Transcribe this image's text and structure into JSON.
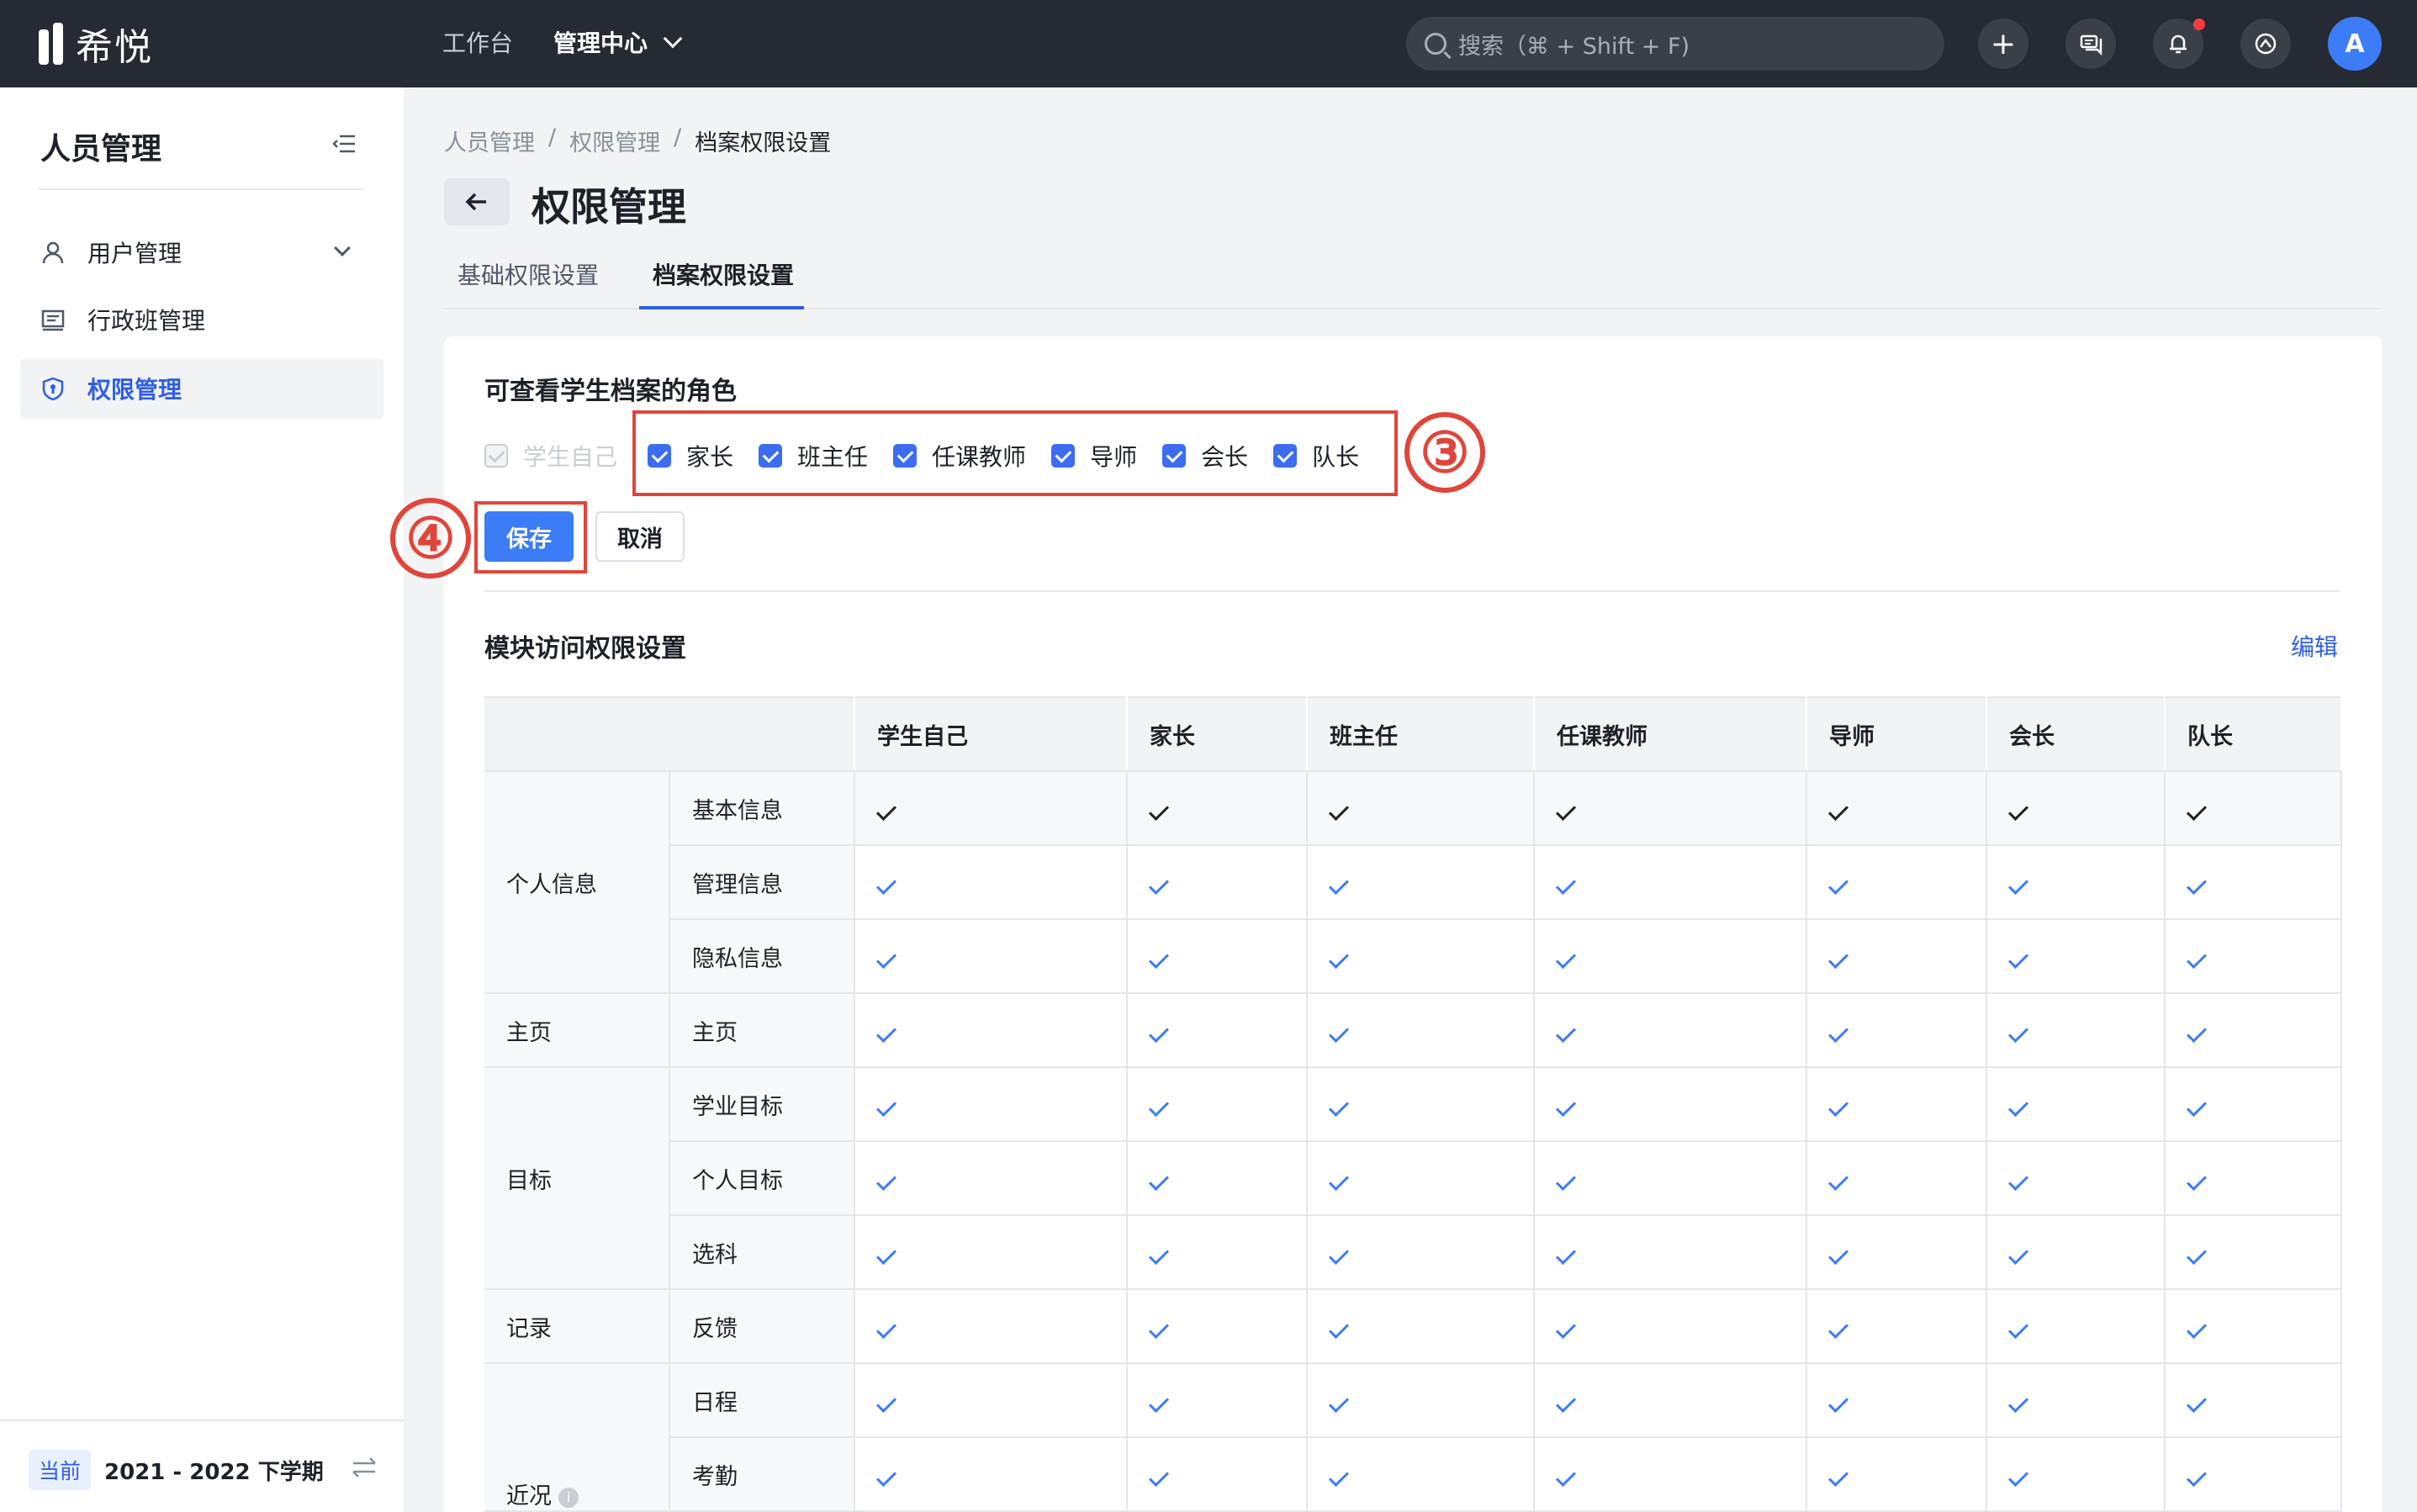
{
  "app": {
    "logo_text": "希悦"
  },
  "topnav": {
    "workbench": "工作台",
    "admin_center": "管理中心",
    "search_placeholder": "搜索（⌘ + Shift + F)",
    "avatar_letter": "A"
  },
  "sidebar": {
    "title": "人员管理",
    "items": [
      {
        "label": "用户管理",
        "icon": "user-icon"
      },
      {
        "label": "行政班管理",
        "icon": "class-list-icon"
      },
      {
        "label": "权限管理",
        "icon": "shield-icon",
        "active": true
      }
    ],
    "term_badge": "当前",
    "term_text": "2021 - 2022 下学期"
  },
  "breadcrumb": [
    "人员管理",
    "/",
    "权限管理",
    "/",
    "档案权限设置"
  ],
  "page_title": "权限管理",
  "tabs": [
    {
      "label": "基础权限设置",
      "active": false
    },
    {
      "label": "档案权限设置",
      "active": true
    }
  ],
  "section_roles": {
    "title": "可查看学生档案的角色",
    "disabled_role": "学生自己",
    "roles": [
      "家长",
      "班主任",
      "任课教师",
      "导师",
      "会长",
      "队长"
    ]
  },
  "annotations": {
    "roles": "③",
    "save": "④"
  },
  "buttons": {
    "save": "保存",
    "cancel": "取消"
  },
  "section_modules": {
    "title": "模块访问权限设置",
    "edit": "编辑"
  },
  "table": {
    "columns": [
      "学生自己",
      "家长",
      "班主任",
      "任课教师",
      "导师",
      "会长",
      "队长"
    ],
    "groups": [
      {
        "name": "个人信息",
        "modules": [
          "基本信息",
          "管理信息",
          "隐私信息"
        ]
      },
      {
        "name": "主页",
        "modules": [
          "主页"
        ]
      },
      {
        "name": "目标",
        "modules": [
          "学业目标",
          "个人目标",
          "选科"
        ]
      },
      {
        "name": "记录",
        "modules": [
          "反馈"
        ]
      },
      {
        "name": "近况",
        "modules": [
          "日程",
          "考勤"
        ]
      }
    ]
  },
  "colors": {
    "accent": "#3c7cf6",
    "annotation": "#e0453a",
    "topbar": "#252a33"
  }
}
